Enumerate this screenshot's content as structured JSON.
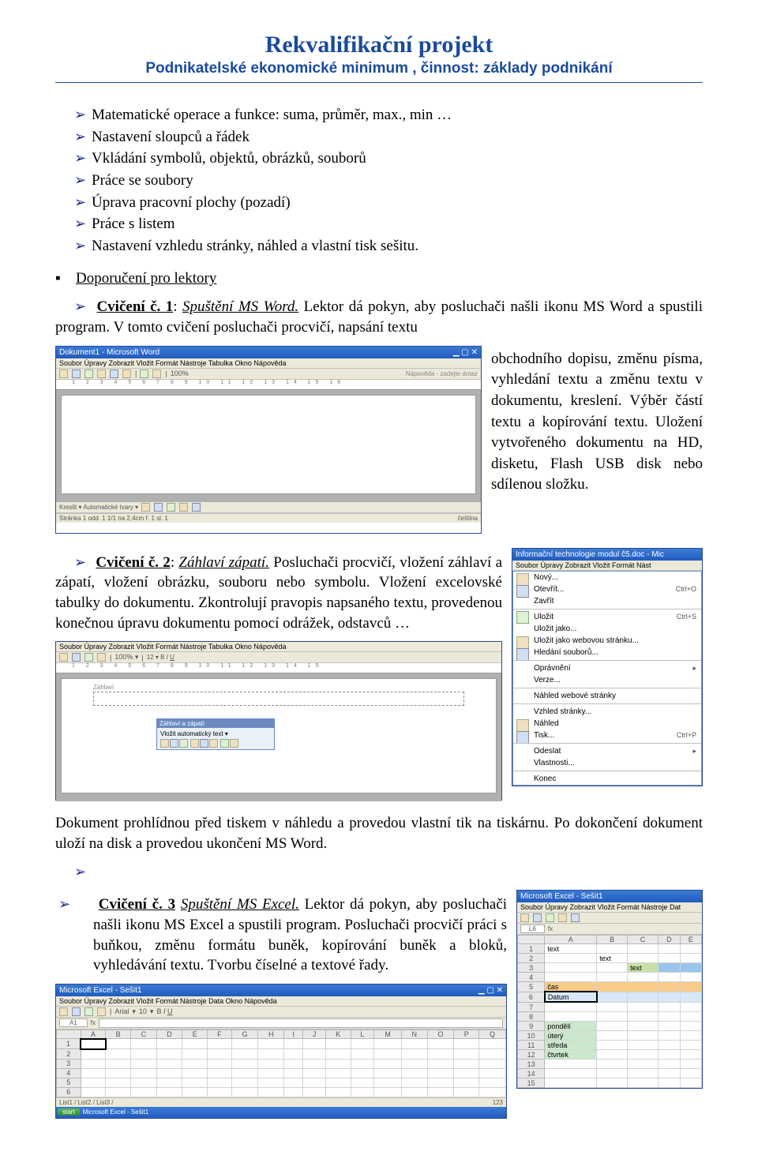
{
  "header": {
    "title": "Rekvalifikační projekt",
    "subtitle": "Podnikatelské ekonomické minimum , činnost: základy podnikání"
  },
  "bullets_top": [
    "Matematické operace a funkce: suma, průměr, max., min …",
    "Nastavení sloupců a řádek",
    "Vkládání symbolů, objektů, obrázků, souborů",
    "Práce se soubory",
    "Úprava pracovní plochy (pozadí)",
    "Práce s listem",
    "Nastavení vzhledu stránky, náhled a vlastní tisk sešitu."
  ],
  "recommend_label": "Doporučení pro lektory",
  "cv1": {
    "label": "Cvičení č. 1",
    "sub": "Spuštění MS Word.",
    "lead": " Lektor  dá pokyn, aby posluchači našli ikonu MS Word   a   spustili   program.     V tomto   cvičení   posluchači   procvičí,   napsání   textu",
    "right": " obchodního        dopisu, změnu  písma,  vyhledání textu    a    změnu    textu v dokumentu,    kreslení. Výběr    částí    textu    a kopírování  textu.  Uložení vytvořeného     dokumentu na   HD,    disketu,   Flash USB  disk  nebo  sdílenou složku."
  },
  "cv2": {
    "label": "Cvičení č. 2",
    "sub": "Záhlaví zápatí.",
    "text": " Posluchači procvičí, vložení záhlaví a zápatí, vložení obrázku, souboru nebo symbolu. Vložení excelovské tabulky do dokumentu. Zkontrolují pravopis napsaného textu, provedenou konečnou úpravu dokumentu pomocí odrážek, odstavců …"
  },
  "cv_mid": "Dokument prohlídnou před tiskem v náhledu a provedou vlastní tik na tiskárnu. Po dokončení dokument uloží na disk a provedou ukončení  MS Word.",
  "cv3": {
    "label": "Cvičení č. 3",
    "sub": "Spuštění MS Excel.",
    "text": " Lektor  dá pokyn, aby posluchači našli ikonu MS Excel a spustili program. Posluchači procvičí práci s buňkou, změnu formátu buněk, kopírování buněk a bloků,  vyhledávání textu. Tvorbu číselné a textové řady."
  },
  "word_shot": {
    "title": "Dokument1 - Microsoft Word",
    "menus": "Soubor   Úpravy   Zobrazit   Vložit   Formát   Nástroje   Tabulka   Okno   Nápověda",
    "zoom": "100%",
    "ruler_marks": "1  2  3  4  5  6  7  8  9  10  11  12  13  14  15  16",
    "status": "Stránka 1    odd. 1    1/1    na 2,4cm   ř. 1   sl. 1",
    "taskhint": "Nápověda - zadejte dotaz",
    "kresli": "Kreslit ▾   Automatické tvary ▾"
  },
  "ctx_menu": {
    "title": "Informační technologie modul č5.doc - Mic",
    "menus": "Soubor   Úpravy   Zobrazit   Vložit   Formát   Nást",
    "items": [
      {
        "l": "Nový...",
        "s": ""
      },
      {
        "l": "Otevřít...",
        "s": "Ctrl+O"
      },
      {
        "l": "Zavřít",
        "s": ""
      },
      {
        "l": "Uložit",
        "s": "Ctrl+S"
      },
      {
        "l": "Uložit jako...",
        "s": ""
      },
      {
        "l": "Uložit jako webovou stránku...",
        "s": ""
      },
      {
        "l": "Hledání souborů...",
        "s": ""
      },
      {
        "l": "Oprávnění",
        "s": "▸"
      },
      {
        "l": "Verze...",
        "s": ""
      },
      {
        "l": "Náhled webové stránky",
        "s": ""
      },
      {
        "l": "Vzhled stránky...",
        "s": ""
      },
      {
        "l": "Náhled",
        "s": ""
      },
      {
        "l": "Tisk...",
        "s": "Ctrl+P"
      },
      {
        "l": "Odeslat",
        "s": "▸"
      },
      {
        "l": "Vlastnosti...",
        "s": ""
      },
      {
        "l": "Konec",
        "s": ""
      }
    ]
  },
  "hf_shot": {
    "menus": "Soubor   Úpravy   Zobrazit   Vložit   Formát   Nástroje   Tabulka   Okno   Nápověda",
    "tb_title": "Záhlaví a zápatí",
    "tb_row": "Vložit automatický text ▾"
  },
  "excel_big": {
    "title": "Microsoft Excel - Sešit1",
    "menus": "Soubor   Úpravy   Zobrazit   Vložit   Formát   Nástroje   Data   Okno   Nápověda",
    "font": "Arial",
    "size": "10",
    "cellref": "A1",
    "cols": [
      "A",
      "B",
      "C",
      "D",
      "E",
      "F",
      "G",
      "H",
      "I",
      "J",
      "K",
      "L",
      "M",
      "N",
      "O",
      "P",
      "Q"
    ],
    "rows": [
      "1",
      "2",
      "3",
      "4",
      "5",
      "6"
    ],
    "sheets": "List1 / List2 / List3 /"
  },
  "excel_small": {
    "title": "Microsoft Excel - Sešit1",
    "menus": "Soubor   Úpravy   Zobrazit   Vložit   Formát   Nástroje   Dat",
    "cellref": "L6",
    "cols": [
      "A",
      "B",
      "C",
      "D",
      "E"
    ],
    "rows": [
      "1",
      "2",
      "3",
      "4",
      "5",
      "6",
      "7",
      "8",
      "9",
      "10",
      "11",
      "12",
      "13",
      "14",
      "15"
    ],
    "cells": {
      "1A": "text",
      "2B": "text",
      "3C": "text",
      "5A": "čas",
      "6A": "Datum",
      "9A": "pondělí",
      "10A": "úterý",
      "11A": "středa",
      "12A": "čtvrtek"
    }
  }
}
